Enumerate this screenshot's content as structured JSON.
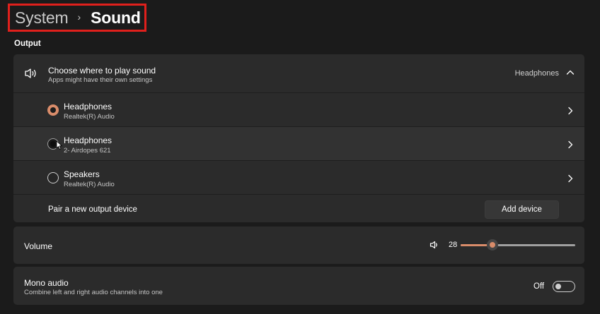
{
  "breadcrumb": {
    "parent": "System",
    "separator": "›",
    "current": "Sound"
  },
  "output": {
    "section_label": "Output",
    "header": {
      "title": "Choose where to play sound",
      "subtitle": "Apps might have their own settings",
      "selected_value": "Headphones",
      "icon": "speaker-icon",
      "expand_icon": "chevron-up-icon"
    },
    "devices": [
      {
        "name": "Headphones",
        "driver": "Realtek(R) Audio",
        "selected": true
      },
      {
        "name": "Headphones",
        "driver": "2- Airdopes 621",
        "selected": false
      },
      {
        "name": "Speakers",
        "driver": "Realtek(R) Audio",
        "selected": false
      }
    ],
    "pair": {
      "label": "Pair a new output device",
      "button_label": "Add device"
    }
  },
  "volume": {
    "label": "Volume",
    "value": "28",
    "level": 28,
    "icon": "volume-icon"
  },
  "mono_audio": {
    "title": "Mono audio",
    "subtitle": "Combine left and right audio channels into one",
    "state_label": "Off",
    "on": false
  },
  "colors": {
    "accent": "#d98c6a",
    "background": "#1b1b1b",
    "card": "#2b2b2b",
    "highlight_box": "#e0201c"
  }
}
